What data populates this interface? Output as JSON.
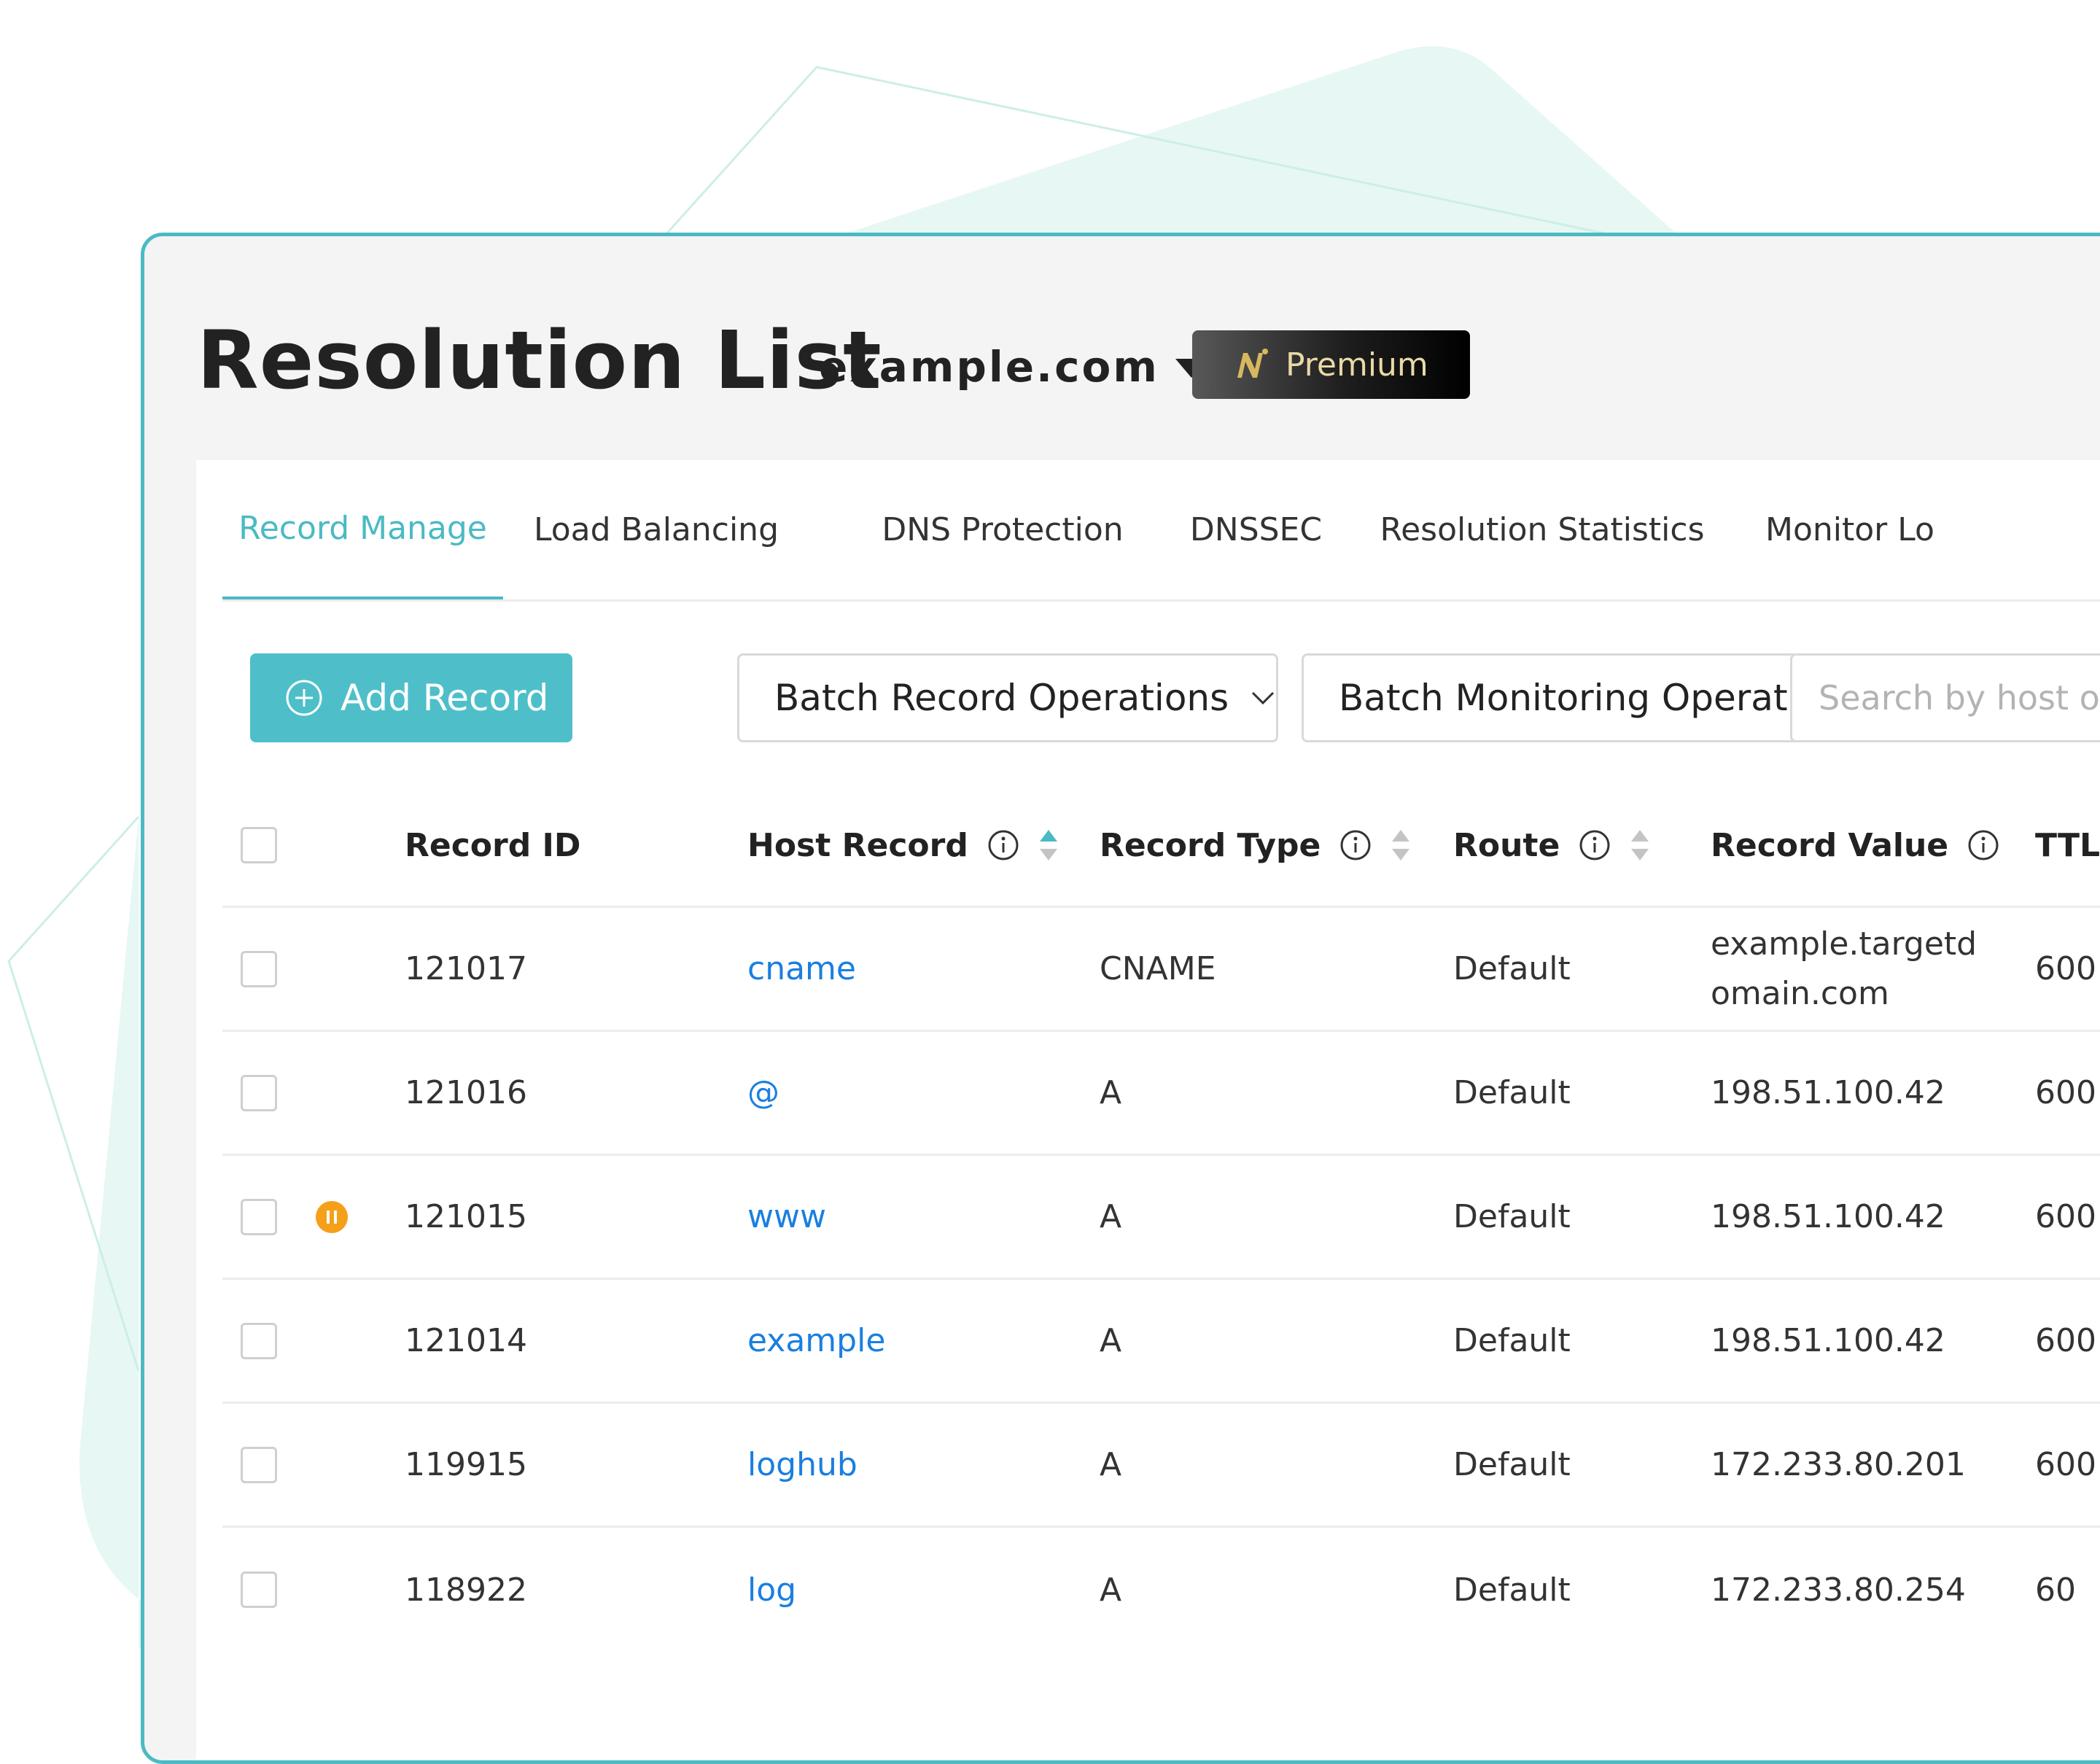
{
  "header": {
    "title": "Resolution List",
    "domain": "example.com",
    "premium_label": "Premium"
  },
  "tabs": [
    {
      "label": "Record Manage",
      "active": true
    },
    {
      "label": "Load Balancing",
      "active": false
    },
    {
      "label": "DNS Protection",
      "active": false
    },
    {
      "label": "DNSSEC",
      "active": false
    },
    {
      "label": "Resolution Statistics",
      "active": false
    },
    {
      "label": "Monitor Lo",
      "active": false
    }
  ],
  "toolbar": {
    "add_record": "Add Record",
    "batch_record": "Batch Record Operations",
    "batch_monitoring": "Batch Monitoring Operations",
    "search_placeholder": "Search by host or re"
  },
  "table": {
    "columns": {
      "record_id": "Record ID",
      "host_record": "Host Record",
      "record_type": "Record Type",
      "route": "Route",
      "record_value": "Record Value",
      "ttl": "TTL"
    },
    "rows": [
      {
        "id": "121017",
        "host": "cname",
        "type": "CNAME",
        "route": "Default",
        "value": "example.targetdomain.com",
        "ttl": "600",
        "paused": false
      },
      {
        "id": "121016",
        "host": "@",
        "type": "A",
        "route": "Default",
        "value": "198.51.100.42",
        "ttl": "600",
        "paused": false
      },
      {
        "id": "121015",
        "host": "www",
        "type": "A",
        "route": "Default",
        "value": "198.51.100.42",
        "ttl": "600",
        "paused": true
      },
      {
        "id": "121014",
        "host": "example",
        "type": "A",
        "route": "Default",
        "value": "198.51.100.42",
        "ttl": "600",
        "paused": false
      },
      {
        "id": "119915",
        "host": "loghub",
        "type": "A",
        "route": "Default",
        "value": "172.233.80.201",
        "ttl": "600",
        "paused": false
      },
      {
        "id": "118922",
        "host": "log",
        "type": "A",
        "route": "Default",
        "value": "172.233.80.254",
        "ttl": "60",
        "paused": false
      }
    ]
  },
  "colors": {
    "accent": "#4bbac3",
    "link": "#1a7fe0",
    "premium_text": "#e9d9a6",
    "pause_badge": "#f5a01a"
  },
  "icons": [
    "plus-circle-icon",
    "chevron-down-icon",
    "info-icon",
    "sort-icon",
    "pause-icon",
    "premium-logo-icon",
    "caret-down-icon"
  ]
}
